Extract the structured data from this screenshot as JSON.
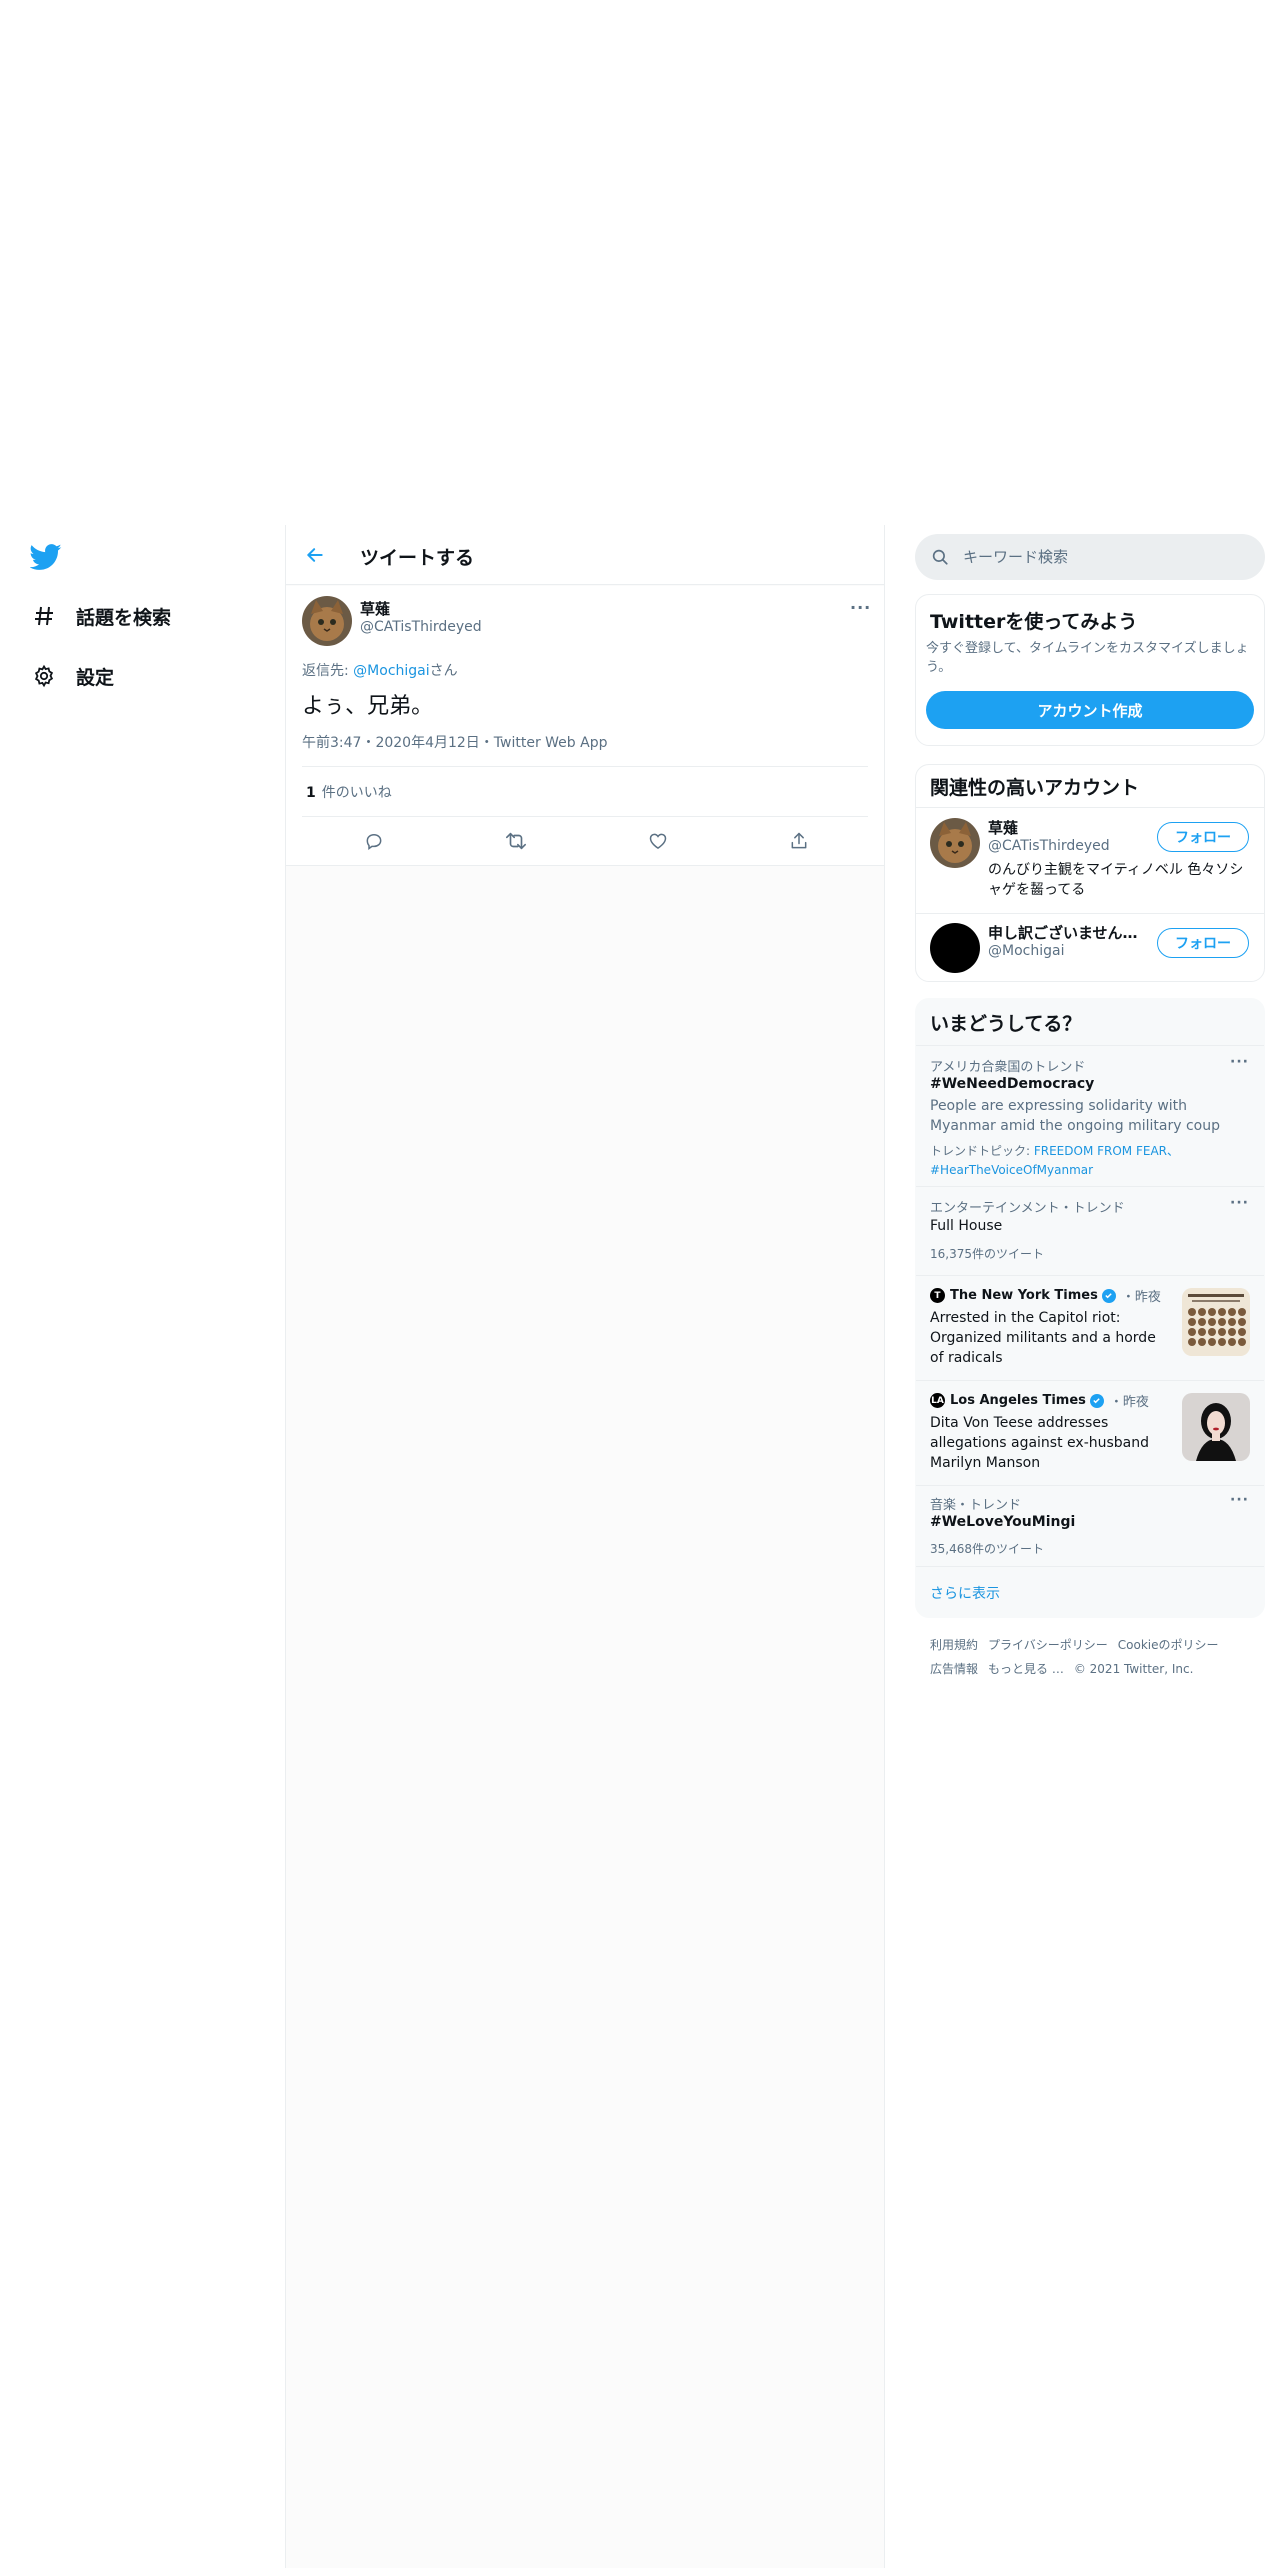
{
  "nav": {
    "items": [
      {
        "label": "話題を検索",
        "icon": "hashtag-icon"
      },
      {
        "label": "設定",
        "icon": "gear-icon"
      }
    ]
  },
  "header": {
    "title": "ツイートする"
  },
  "tweet": {
    "author_name": "草薙",
    "author_handle": "@CATisThirdeyed",
    "reply_prefix": "返信先: ",
    "reply_to": "@Mochigai",
    "reply_suffix": "さん",
    "text": "よぅ、兄弟。",
    "meta": "午前3:47・2020年4月12日・Twitter Web App",
    "like_count": "1",
    "like_label": "件のいいね"
  },
  "search": {
    "placeholder": "キーワード検索"
  },
  "signup": {
    "title": "Twitterを使ってみよう",
    "description": "今すぐ登録して、タイムラインをカスタマイズしましょう。",
    "button": "アカウント作成"
  },
  "accounts": {
    "title": "関連性の高いアカウント",
    "follow_label": "フォロー",
    "items": [
      {
        "name": "草薙",
        "handle": "@CATisThirdeyed",
        "bio": "のんびり主観をマイティノベル 色々ソシャゲを齧ってる"
      },
      {
        "name": "申し訳ございません…",
        "handle": "@Mochigai",
        "bio": ""
      }
    ]
  },
  "trends": {
    "title": "いまどうしてる？",
    "items": [
      {
        "context": "アメリカ合衆国のトレンド",
        "title": "#WeNeedDemocracy",
        "description": "People are expressing solidarity with Myanmar amid the ongoing military coup",
        "topic_prefix": "トレンドトピック: ",
        "topic_links": "FREEDOM FROM FEAR、#HearTheVoiceOfMyanmar"
      },
      {
        "context": "エンターテインメント・トレンド",
        "title": "Full House",
        "count": "16,375件のツイート"
      },
      {
        "source": "The New York Times",
        "time": "・昨夜",
        "title": "Arrested in the Capitol riot: Organized militants and a horde of radicals"
      },
      {
        "source": "Los Angeles Times",
        "time": "・昨夜",
        "title": "Dita Von Teese addresses allegations against ex-husband Marilyn Manson"
      },
      {
        "context": "音楽・トレンド",
        "title": "#WeLoveYouMingi",
        "count": "35,468件のツイート"
      }
    ],
    "show_more": "さらに表示"
  },
  "footer": {
    "line1": [
      "利用規約",
      "プライバシーポリシー",
      "Cookieのポリシー"
    ],
    "line2": [
      "広告情報",
      "もっと見る …",
      "© 2021 Twitter, Inc."
    ]
  },
  "colors": {
    "accent": "#1da1f2",
    "link": "#1b95e0",
    "secondary_text": "#5b7083",
    "border": "#ebeef0"
  }
}
